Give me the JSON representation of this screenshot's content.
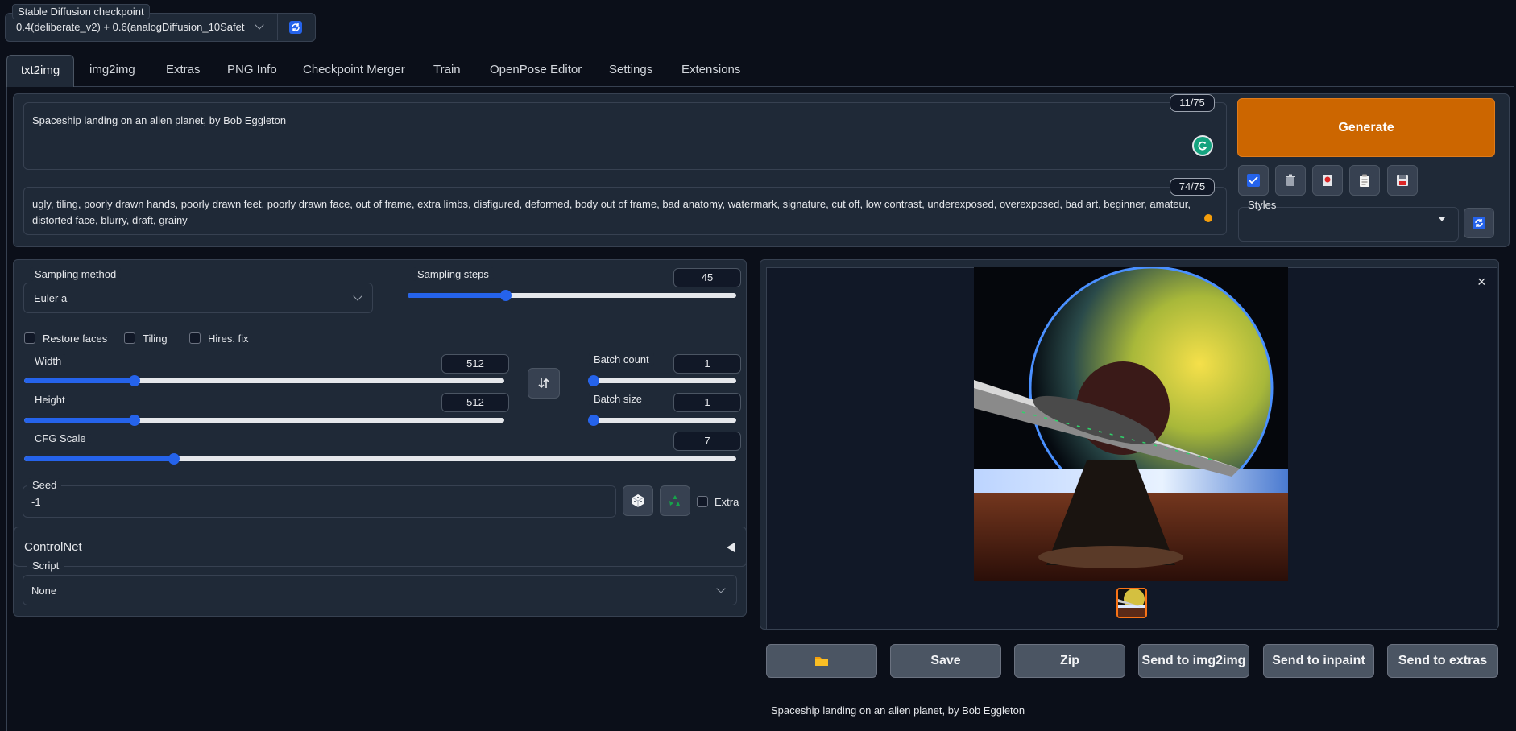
{
  "checkpoint": {
    "label": "Stable Diffusion checkpoint",
    "value": "0.4(deliberate_v2) + 0.6(analogDiffusion_10Safet"
  },
  "tabs": [
    "txt2img",
    "img2img",
    "Extras",
    "PNG Info",
    "Checkpoint Merger",
    "Train",
    "OpenPose Editor",
    "Settings",
    "Extensions"
  ],
  "prompt": {
    "text": "Spaceship landing on an alien planet, by Bob Eggleton",
    "counter": "11/75"
  },
  "negative_prompt": {
    "text": "ugly, tiling, poorly drawn hands, poorly drawn feet, poorly drawn face, out of frame, extra limbs, disfigured, deformed, body out of frame, bad anatomy, watermark, signature, cut off, low contrast, underexposed, overexposed, bad art, beginner, amateur, distorted face, blurry, draft, grainy",
    "counter": "74/75"
  },
  "generate_label": "Generate",
  "styles_label": "Styles",
  "sampling": {
    "method_label": "Sampling method",
    "method_value": "Euler a",
    "steps_label": "Sampling steps",
    "steps_value": "45",
    "steps_fraction": 0.3
  },
  "checkboxes": {
    "restore_faces": "Restore faces",
    "tiling": "Tiling",
    "hires_fix": "Hires. fix"
  },
  "width": {
    "label": "Width",
    "value": "512",
    "fraction": 0.23
  },
  "height": {
    "label": "Height",
    "value": "512",
    "fraction": 0.23
  },
  "batch_count": {
    "label": "Batch count",
    "value": "1",
    "fraction": 0.0
  },
  "batch_size": {
    "label": "Batch size",
    "value": "1",
    "fraction": 0.0
  },
  "cfg": {
    "label": "CFG Scale",
    "value": "7",
    "fraction": 0.21
  },
  "seed": {
    "label": "Seed",
    "value": "-1",
    "extra_label": "Extra"
  },
  "controlnet_label": "ControlNet",
  "script": {
    "label": "Script",
    "value": "None"
  },
  "output_buttons": {
    "save": "Save",
    "zip": "Zip",
    "send_img2img": "Send to img2img",
    "send_inpaint": "Send to inpaint",
    "send_extras": "Send to extras"
  },
  "output_caption": "Spaceship landing on an alien planet, by Bob Eggleton",
  "colors": {
    "accent": "#2563eb",
    "generate": "#cc6600",
    "background": "#0b0f19"
  }
}
